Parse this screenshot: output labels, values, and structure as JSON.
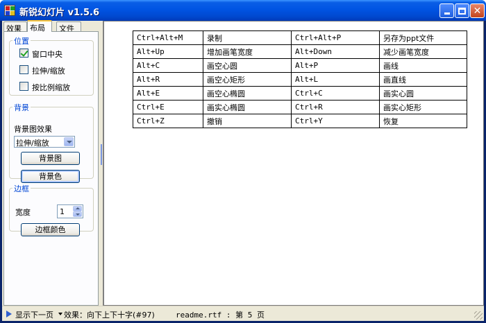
{
  "window": {
    "title": "新锐幻灯片 v1.5.6",
    "controls": [
      "minimize",
      "maximize",
      "close"
    ]
  },
  "left_panel": {
    "tabs": [
      {
        "label": "效果",
        "active": false
      },
      {
        "label": "布局",
        "active": true
      },
      {
        "label": "文件",
        "active": false
      }
    ],
    "position_group": {
      "title": "位置",
      "options": [
        {
          "label": "窗口中央",
          "checked": true
        },
        {
          "label": "拉伸/缩放",
          "checked": false
        },
        {
          "label": "按比例缩放",
          "checked": false
        }
      ]
    },
    "background_group": {
      "title": "背景",
      "effect_label": "背景图效果",
      "effect_value": "拉伸/缩放",
      "image_button": "背景图",
      "color_button": "背景色"
    },
    "border_group": {
      "title": "边框",
      "width_label": "宽度",
      "width_value": "1",
      "color_button": "边框颜色"
    }
  },
  "shortcut_table": [
    [
      "Ctrl+Alt+M",
      "录制",
      "Ctrl+Alt+P",
      "另存为ppt文件"
    ],
    [
      "Alt+Up",
      "增加画笔宽度",
      "Alt+Down",
      "减少画笔宽度"
    ],
    [
      "Alt+C",
      "画空心圆",
      "Alt+P",
      "画线"
    ],
    [
      "Alt+R",
      "画空心矩形",
      "Alt+L",
      "画直线"
    ],
    [
      "Alt+E",
      "画空心椭圆",
      "Ctrl+C",
      "画实心圆"
    ],
    [
      "Ctrl+E",
      "画实心椭圆",
      "Ctrl+R",
      "画实心矩形"
    ],
    [
      "Ctrl+Z",
      "撤销",
      "Ctrl+Y",
      "恢复"
    ]
  ],
  "statusbar": {
    "next_label": "显示下一页",
    "effect_text": "效果：向下上下十字(#97)",
    "file_text": "readme.rtf : 第 5 页"
  },
  "colors": {
    "titlebar": "#0054e3",
    "group_title": "#0046d5",
    "window_bg": "#ece9d8"
  }
}
